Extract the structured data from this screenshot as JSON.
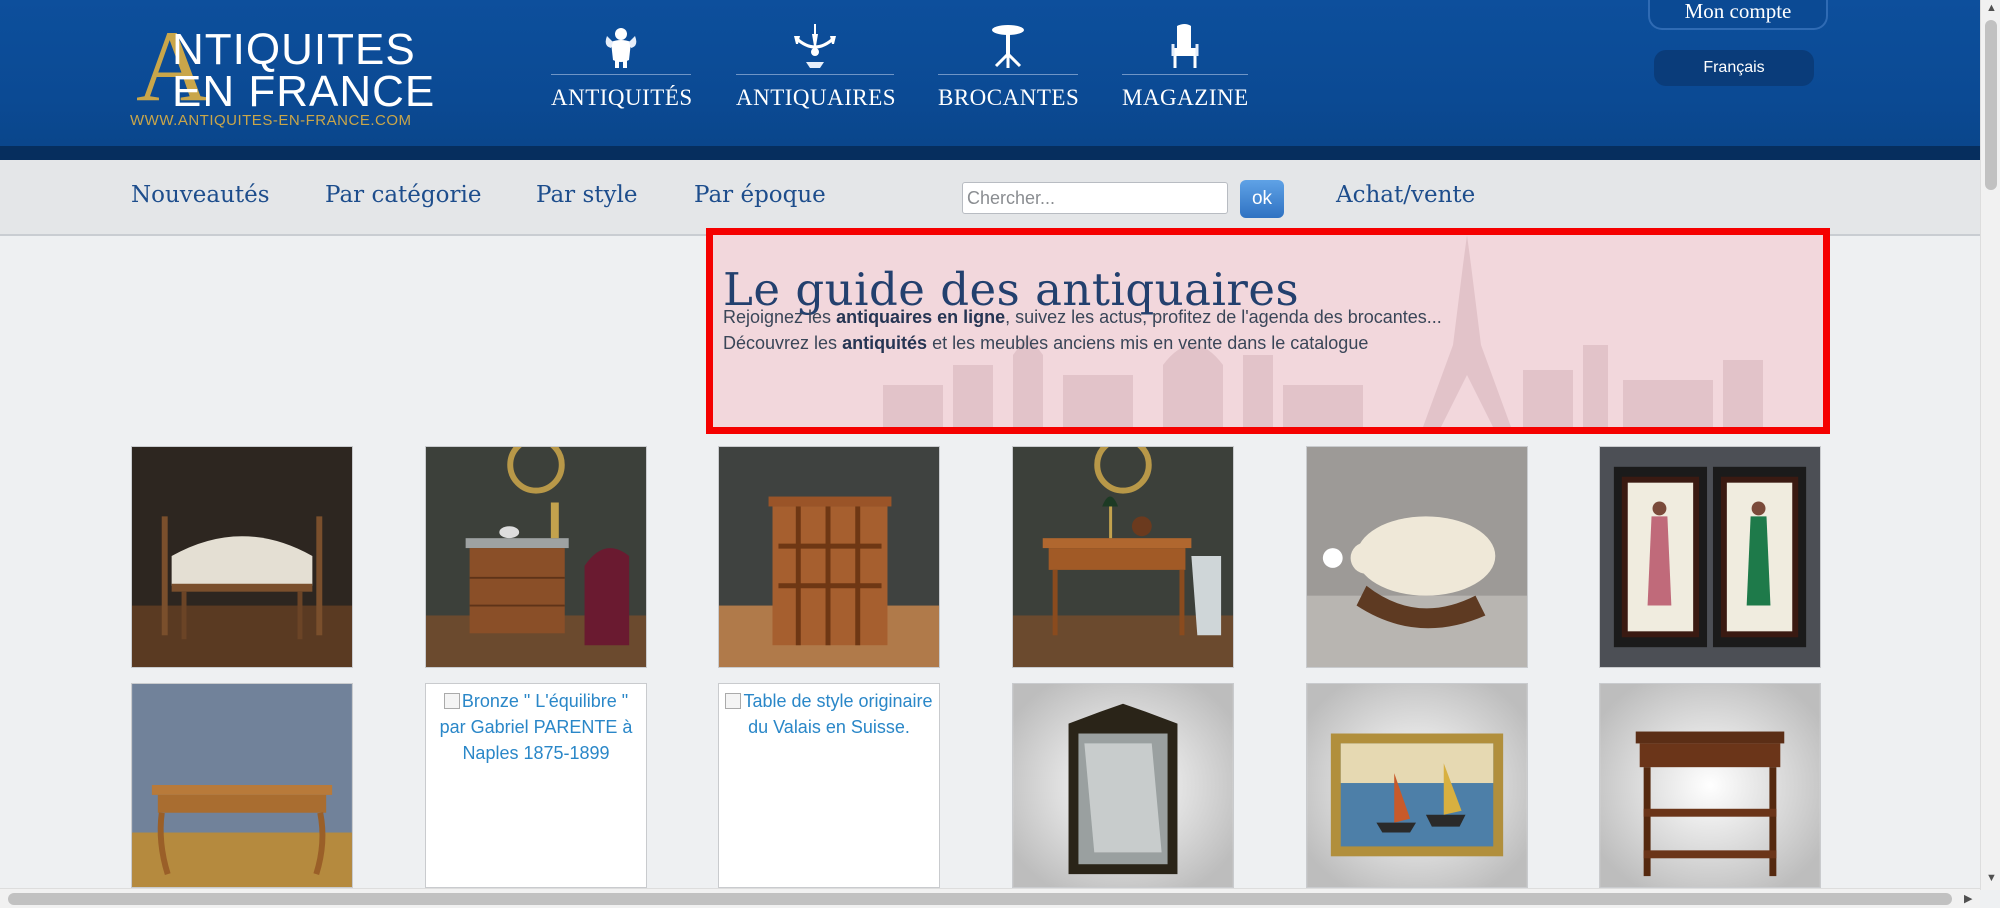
{
  "header": {
    "logo": {
      "letter": "A",
      "line1": "NTIQUITES",
      "line2": "EN FRANCE",
      "url": "WWW.ANTIQUITES-EN-FRANCE.COM"
    },
    "nav": [
      {
        "label": "ANTIQUITÉS",
        "icon": "cherub-icon"
      },
      {
        "label": "ANTIQUAIRES",
        "icon": "chandelier-icon"
      },
      {
        "label": "BROCANTES",
        "icon": "pedestal-table-icon"
      },
      {
        "label": "MAGAZINE",
        "icon": "armchair-icon"
      }
    ],
    "account": "Mon compte",
    "language": "Français"
  },
  "subnav": {
    "links": [
      "Nouveautés",
      "Par catégorie",
      "Par style",
      "Par époque"
    ],
    "search_placeholder": "Chercher...",
    "search_button": "ok",
    "achat_vente": "Achat/vente"
  },
  "guide": {
    "title": "Le guide des antiquaires",
    "line1_a": "Rejoignez les ",
    "line1_b": "antiquaires en ligne",
    "line1_c": ", suivez les actus, profitez de l'agenda des brocantes...",
    "line2_a": "Découvrez les ",
    "line2_b": "antiquités",
    "line2_c": " et les meubles anciens mis en vente dans le catalogue"
  },
  "products": {
    "row1": [
      {
        "icon": "bench-stool-image"
      },
      {
        "icon": "chest-of-drawers-image"
      },
      {
        "icon": "revolving-bookcase-image"
      },
      {
        "icon": "writing-desk-image"
      },
      {
        "icon": "ivory-elephant-image"
      },
      {
        "icon": "chinese-paintings-image"
      }
    ],
    "row2": [
      {
        "icon": "farm-table-image"
      },
      {
        "alt": "Bronze \" L'équilibre \" par Gabriel PARENTE à Naples 1875-1899"
      },
      {
        "alt": "Table de style originaire du Valais en Suisse."
      },
      {
        "icon": "gilded-mirror-image"
      },
      {
        "icon": "harbour-painting-image"
      },
      {
        "icon": "side-table-image"
      }
    ]
  },
  "colors": {
    "header_blue": "#0b4a94",
    "gold": "#c9a64a",
    "nav_text": "#1d4d8c",
    "highlight_border": "#f50000"
  }
}
